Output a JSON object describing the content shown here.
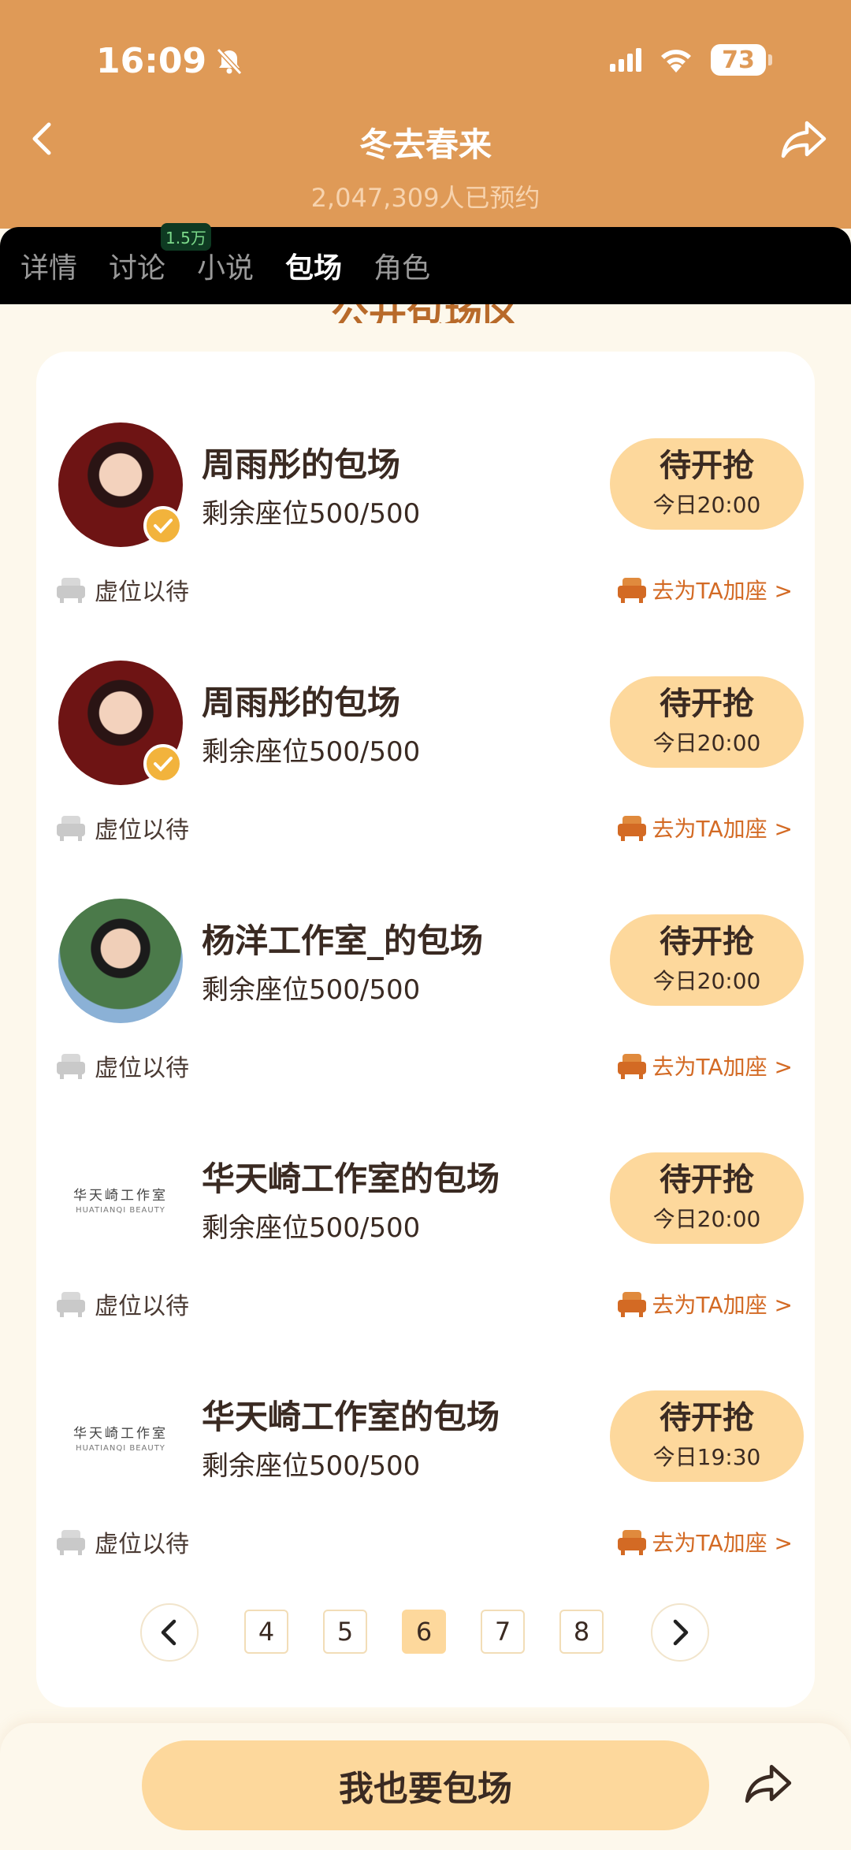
{
  "status": {
    "time": "16:09",
    "battery": "73"
  },
  "header": {
    "title": "冬去春来",
    "subtitle": "2,047,309人已预约"
  },
  "tabs": [
    {
      "label": "详情"
    },
    {
      "label": "讨论",
      "badge": "1.5万"
    },
    {
      "label": "小说"
    },
    {
      "label": "包场"
    },
    {
      "label": "角色"
    }
  ],
  "section_title": "公开包场区",
  "items": [
    {
      "name": "周雨彤的包场",
      "seats": "剩余座位500/500",
      "button_label": "待开抢",
      "button_time": "今日20:00",
      "virtual": "虚位以待",
      "add_seat": "去为TA加座 >",
      "avatar": "red-portrait",
      "verified": true
    },
    {
      "name": "周雨彤的包场",
      "seats": "剩余座位500/500",
      "button_label": "待开抢",
      "button_time": "今日20:00",
      "virtual": "虚位以待",
      "add_seat": "去为TA加座 >",
      "avatar": "red-portrait",
      "verified": true
    },
    {
      "name": "杨洋工作室_的包场",
      "seats": "剩余座位500/500",
      "button_label": "待开抢",
      "button_time": "今日20:00",
      "virtual": "虚位以待",
      "add_seat": "去为TA加座 >",
      "avatar": "green-portrait",
      "verified": false
    },
    {
      "name": "华天崎工作室的包场",
      "seats": "剩余座位500/500",
      "button_label": "待开抢",
      "button_time": "今日20:00",
      "virtual": "虚位以待",
      "add_seat": "去为TA加座 >",
      "avatar": "logo",
      "logo_cn": "华天崎工作室",
      "logo_en": "HUATIANQI BEAUTY",
      "verified": false
    },
    {
      "name": "华天崎工作室的包场",
      "seats": "剩余座位500/500",
      "button_label": "待开抢",
      "button_time": "今日19:30",
      "virtual": "虚位以待",
      "add_seat": "去为TA加座 >",
      "avatar": "logo",
      "logo_cn": "华天崎工作室",
      "logo_en": "HUATIANQI BEAUTY",
      "verified": false
    }
  ],
  "pagination": {
    "pages": [
      "4",
      "5",
      "6",
      "7",
      "8"
    ],
    "current": "6"
  },
  "bottom": {
    "cta": "我也要包场"
  },
  "colors": {
    "header": "#df9a57",
    "button": "#fdd89c",
    "accent": "#d36a24",
    "background": "#fdf8ec"
  }
}
